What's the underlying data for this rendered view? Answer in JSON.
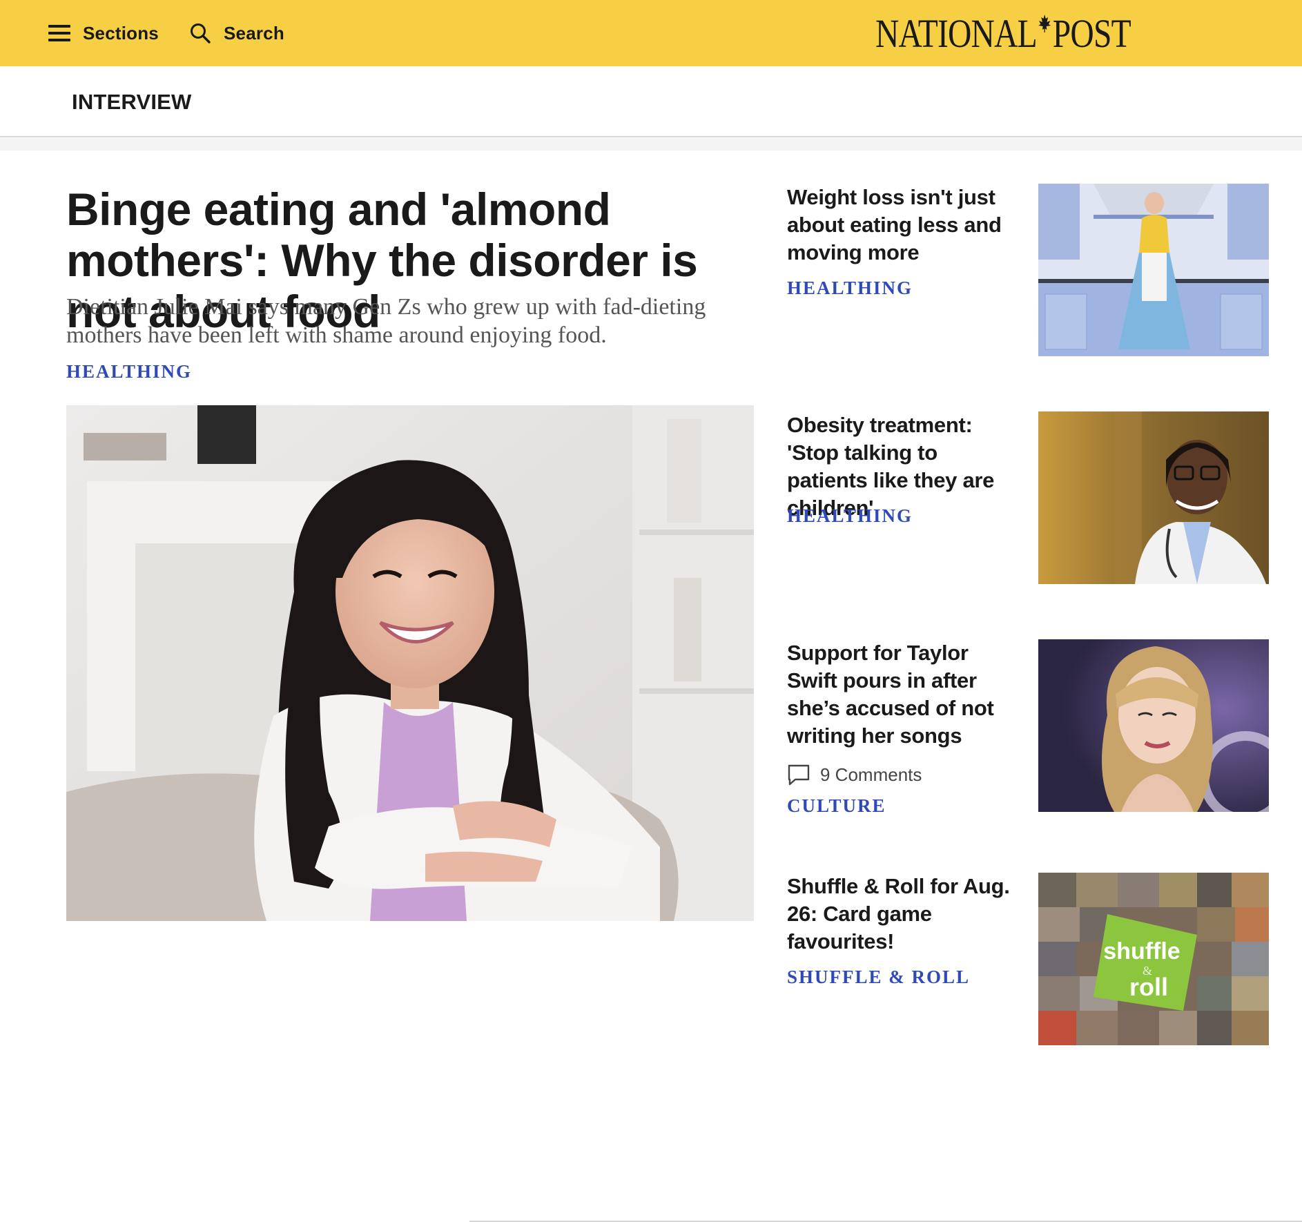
{
  "header": {
    "sections_label": "Sections",
    "search_label": "Search",
    "logo_left": "NATIONAL",
    "logo_right": "POST",
    "background_color": "#f6cf45"
  },
  "subheader": {
    "title": "INTERVIEW"
  },
  "main_article": {
    "title": "Binge eating and 'almond mothers': Why the disorder is not about food",
    "dek": "Dietitian Julie Mai says many Gen Zs who grew up with fad-dieting mothers have been left with shame around enjoying food.",
    "tag": "HEALTHING",
    "image_alt": "Smiling woman with long dark hair in a white blazer seated in a bright living room"
  },
  "sidebar": {
    "items": [
      {
        "title": "Weight loss isn't just about eating less and moving more",
        "tag": "HEALTHING",
        "image_alt": "Woman in retro yellow top and blue skirt in a blue kitchen"
      },
      {
        "title": "Obesity treatment: 'Stop talking to patients like they are children'",
        "tag": "HEALTHING",
        "image_alt": "Smiling doctor with glasses wearing a white coat and stethoscope"
      },
      {
        "title": "Support for Taylor Swift pours in after she’s accused of not writing her songs",
        "comments": "9 Comments",
        "tag": "CULTURE",
        "image_alt": "Taylor Swift with blonde hair and bangs on a purple backdrop"
      },
      {
        "title": "Shuffle & Roll for Aug. 26: Card game favourites!",
        "tag": "SHUFFLE & ROLL",
        "image_alt": "Collage of board game photos with shuffle & roll logo",
        "logo_text_top": "shuffle",
        "logo_text_amp": "&",
        "logo_text_bottom": "roll"
      }
    ]
  },
  "colors": {
    "tag": "#2f49b6",
    "text": "#1a1a1a",
    "dek": "#555555"
  }
}
